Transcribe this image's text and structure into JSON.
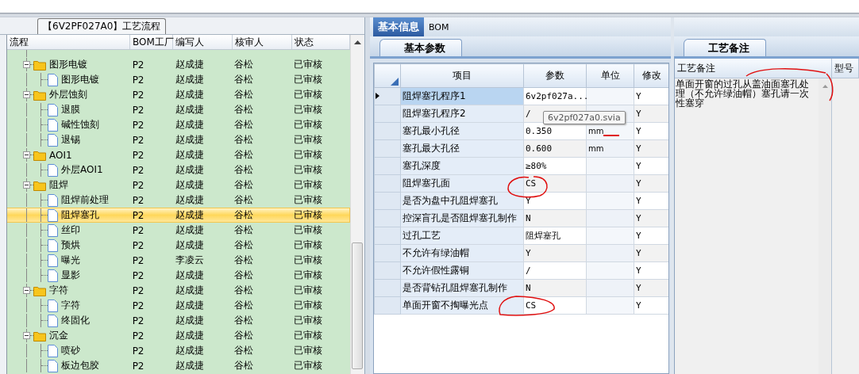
{
  "flow_panel": {
    "title": "【6V2PF027A0】工艺流程",
    "columns": [
      "流程",
      "BOM工厂",
      "编写人",
      "核审人",
      "状态"
    ],
    "nodes": [
      {
        "name": "图形电镀",
        "factory": "P2",
        "author": "赵成捷",
        "reviewer": "谷松",
        "status": "已审核",
        "selected": false,
        "expanded": true,
        "children": [
          {
            "name": "图形电镀",
            "factory": "P2",
            "author": "赵成捷",
            "reviewer": "谷松",
            "status": "已审核",
            "selected": false
          }
        ]
      },
      {
        "name": "外层蚀刻",
        "factory": "P2",
        "author": "赵成捷",
        "reviewer": "谷松",
        "status": "已审核",
        "selected": false,
        "expanded": true,
        "children": [
          {
            "name": "退膜",
            "factory": "P2",
            "author": "赵成捷",
            "reviewer": "谷松",
            "status": "已审核",
            "selected": false
          },
          {
            "name": "碱性蚀刻",
            "factory": "P2",
            "author": "赵成捷",
            "reviewer": "谷松",
            "status": "已审核",
            "selected": false
          },
          {
            "name": "退锡",
            "factory": "P2",
            "author": "赵成捷",
            "reviewer": "谷松",
            "status": "已审核",
            "selected": false
          }
        ]
      },
      {
        "name": "AOI1",
        "factory": "P2",
        "author": "赵成捷",
        "reviewer": "谷松",
        "status": "已审核",
        "selected": false,
        "expanded": true,
        "children": [
          {
            "name": "外层AOI1",
            "factory": "P2",
            "author": "赵成捷",
            "reviewer": "谷松",
            "status": "已审核",
            "selected": false
          }
        ]
      },
      {
        "name": "阻焊",
        "factory": "P2",
        "author": "赵成捷",
        "reviewer": "谷松",
        "status": "已审核",
        "selected": false,
        "expanded": true,
        "children": [
          {
            "name": "阻焊前处理",
            "factory": "P2",
            "author": "赵成捷",
            "reviewer": "谷松",
            "status": "已审核",
            "selected": false
          },
          {
            "name": "阻焊塞孔",
            "factory": "P2",
            "author": "赵成捷",
            "reviewer": "谷松",
            "status": "已审核",
            "selected": true
          },
          {
            "name": "丝印",
            "factory": "P2",
            "author": "赵成捷",
            "reviewer": "谷松",
            "status": "已审核",
            "selected": false
          },
          {
            "name": "预烘",
            "factory": "P2",
            "author": "赵成捷",
            "reviewer": "谷松",
            "status": "已审核",
            "selected": false
          },
          {
            "name": "曝光",
            "factory": "P2",
            "author": "李凌云",
            "reviewer": "谷松",
            "status": "已审核",
            "selected": false
          },
          {
            "name": "显影",
            "factory": "P2",
            "author": "赵成捷",
            "reviewer": "谷松",
            "status": "已审核",
            "selected": false
          }
        ]
      },
      {
        "name": "字符",
        "factory": "P2",
        "author": "赵成捷",
        "reviewer": "谷松",
        "status": "已审核",
        "selected": false,
        "expanded": true,
        "children": [
          {
            "name": "字符",
            "factory": "P2",
            "author": "赵成捷",
            "reviewer": "谷松",
            "status": "已审核",
            "selected": false
          },
          {
            "name": "终固化",
            "factory": "P2",
            "author": "赵成捷",
            "reviewer": "谷松",
            "status": "已审核",
            "selected": false
          }
        ]
      },
      {
        "name": "沉金",
        "factory": "P2",
        "author": "赵成捷",
        "reviewer": "谷松",
        "status": "已审核",
        "selected": false,
        "expanded": true,
        "children": [
          {
            "name": "喷砂",
            "factory": "P2",
            "author": "赵成捷",
            "reviewer": "谷松",
            "status": "已审核",
            "selected": false
          },
          {
            "name": "板边包胶",
            "factory": "P2",
            "author": "赵成捷",
            "reviewer": "谷松",
            "status": "已审核",
            "selected": false
          }
        ]
      }
    ]
  },
  "info_panel": {
    "tabs": [
      {
        "label": "基本信息",
        "selected": true
      },
      {
        "label": "BOM",
        "selected": false
      }
    ],
    "subtab": "基本参数",
    "columns": [
      "项目",
      "参数",
      "单位",
      "修改"
    ],
    "rows": [
      {
        "item": "阻焊塞孔程序1",
        "value": "6v2pf027a...",
        "unit": "",
        "modified": "Y",
        "selected": true
      },
      {
        "item": "阻焊塞孔程序2",
        "value": "/",
        "unit": "",
        "modified": "Y",
        "selected": false
      },
      {
        "item": "塞孔最小孔径",
        "value": "0.350",
        "unit": "mm",
        "modified": "Y",
        "selected": false
      },
      {
        "item": "塞孔最大孔径",
        "value": "0.600",
        "unit": "mm",
        "modified": "Y",
        "selected": false
      },
      {
        "item": "塞孔深度",
        "value": "≥80%",
        "unit": "",
        "modified": "Y",
        "selected": false
      },
      {
        "item": "阻焊塞孔面",
        "value": "CS",
        "unit": "",
        "modified": "Y",
        "selected": false
      },
      {
        "item": "是否为盘中孔阻焊塞孔",
        "value": "Y",
        "unit": "",
        "modified": "Y",
        "selected": false
      },
      {
        "item": "控深盲孔是否阻焊塞孔制作",
        "value": "N",
        "unit": "",
        "modified": "Y",
        "selected": false
      },
      {
        "item": "过孔工艺",
        "value": "阻焊塞孔",
        "unit": "",
        "modified": "Y",
        "selected": false
      },
      {
        "item": "不允许有绿油帽",
        "value": "Y",
        "unit": "",
        "modified": "Y",
        "selected": false
      },
      {
        "item": "不允许假性露铜",
        "value": "/",
        "unit": "",
        "modified": "Y",
        "selected": false
      },
      {
        "item": "是否背钻孔阻焊塞孔制作",
        "value": "N",
        "unit": "",
        "modified": "Y",
        "selected": false
      },
      {
        "item": "单面开窗不掏曝光点",
        "value": "CS",
        "unit": "",
        "modified": "Y",
        "selected": false
      }
    ],
    "tooltip": "6v2pf027a0.svia"
  },
  "notes_panel": {
    "tab": "工艺备注",
    "columns": [
      "工艺备注",
      "型号"
    ],
    "note": "单面开窗的过孔从盖油面塞孔处理（不允许绿油帽）塞孔请一次性塞穿"
  }
}
